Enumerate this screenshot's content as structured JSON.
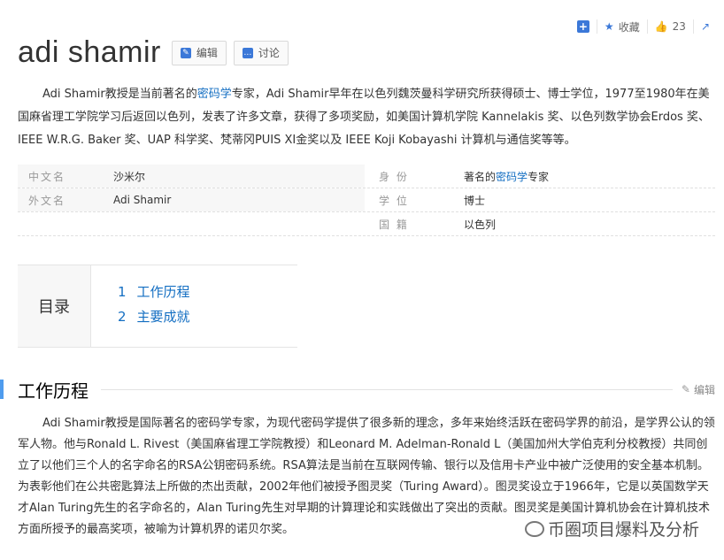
{
  "toolbar": {
    "collect_label": "收藏",
    "like_count": "23"
  },
  "title": "adi shamir",
  "buttons": {
    "edit": "编辑",
    "discuss": "讨论"
  },
  "intro": {
    "p1": "Adi Shamir教授是当前著名的",
    "link": "密码学",
    "p2": "专家，Adi Shamir早年在以色列魏茨曼科学研究所获得硕士、博士学位，1977至1980年在美国麻省理工学院学习后返回以色列，发表了许多文章，获得了多项奖励，如美国计算机学院 Kannelakis 奖、以色列数学协会Erdos 奖、IEEE W.R.G. Baker 奖、UAP 科学奖、梵蒂冈PUIS XI金奖以及 IEEE Koji Kobayashi 计算机与通信奖等等。"
  },
  "info": {
    "left": [
      {
        "k": "中文名",
        "v": "沙米尔"
      },
      {
        "k": "外文名",
        "v": "Adi Shamir"
      }
    ],
    "right": [
      {
        "k": "身 份",
        "v1": "著名的",
        "link": "密码学",
        "v2": "专家"
      },
      {
        "k": "学 位",
        "v": "博士"
      },
      {
        "k": "国 籍",
        "v": "以色列"
      }
    ]
  },
  "toc": {
    "label": "目录",
    "items": [
      {
        "num": "1",
        "text": "工作历程"
      },
      {
        "num": "2",
        "text": "主要成就"
      }
    ]
  },
  "section": {
    "title": "工作历程",
    "edit": "编辑"
  },
  "body": "Adi Shamir教授是国际著名的密码学专家，为现代密码学提供了很多新的理念，多年来始终活跃在密码学界的前沿，是学界公认的领军人物。他与Ronald L. Rivest（美国麻省理工学院教授）和Leonard M. Adelman-Ronald L（美国加州大学伯克利分校教授）共同创立了以他们三个人的名字命名的RSA公钥密码系统。RSA算法是当前在互联网传输、银行以及信用卡产业中被广泛使用的安全基本机制。为表彰他们在公共密匙算法上所做的杰出贡献，2002年他们被授予图灵奖（Turing Award）。图灵奖设立于1966年，它是以英国数学天才Alan Turing先生的名字命名的，Alan Turing先生对早期的计算理论和实践做出了突出的贡献。图灵奖是美国计算机协会在计算机技术方面所授予的最高奖项，被喻为计算机界的诺贝尔奖。",
  "watermark": "币圈项目爆料及分析"
}
